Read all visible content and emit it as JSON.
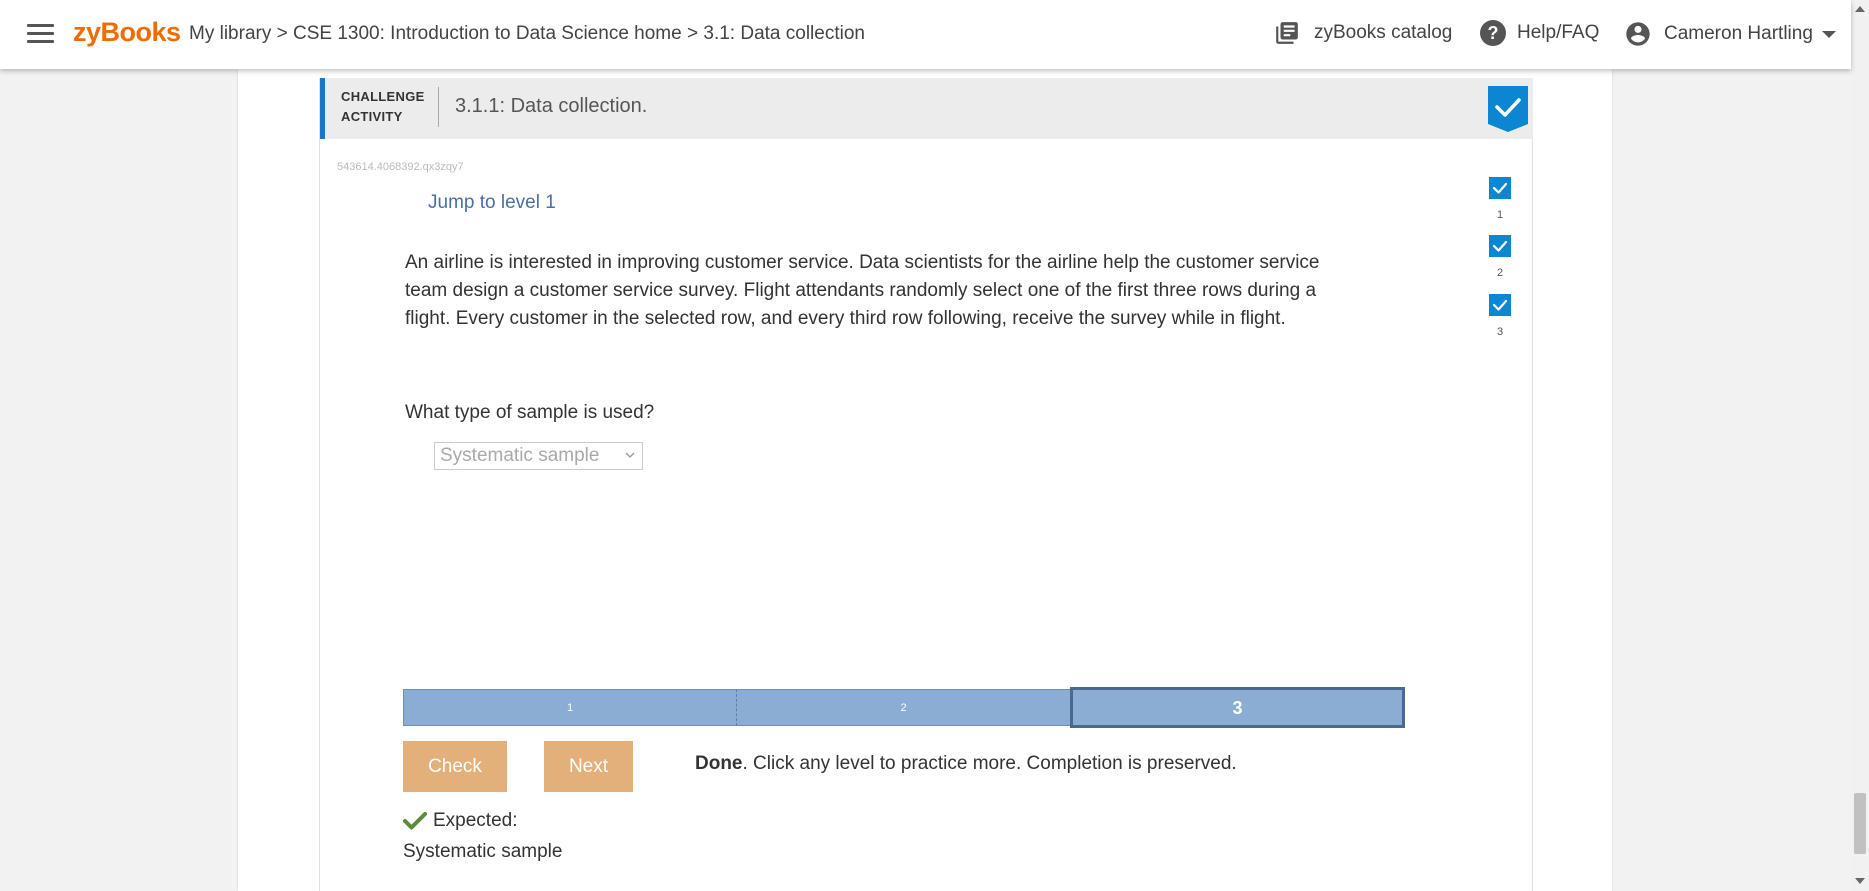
{
  "topbar": {
    "logo": "zyBooks",
    "breadcrumb": {
      "library": "My library",
      "sep1": ">",
      "course": "CSE 1300: Introduction to Data Science home",
      "sep2": ">",
      "section": "3.1: Data collection"
    },
    "catalog_label": "zyBooks catalog",
    "help_label": "Help/FAQ",
    "help_glyph": "?",
    "user_name": "Cameron Hartling"
  },
  "activity": {
    "type_label_line1": "CHALLENGE",
    "type_label_line2": "ACTIVITY",
    "title": "3.1.1: Data collection.",
    "code_id": "543614.4068392.qx3zqy7",
    "jump_label": "Jump to level 1",
    "levels": [
      {
        "num": "1"
      },
      {
        "num": "2"
      },
      {
        "num": "3"
      }
    ],
    "prompt": "An airline is interested in improving customer service. Data scientists for the airline help the customer service team design a customer service survey. Flight attendants randomly select one of the first three rows during a flight. Every customer in the selected row, and every third row following, receive the survey while in flight.",
    "question": "What type of sample is used?",
    "selected_answer": "Systematic sample",
    "progress": [
      "1",
      "2",
      "3"
    ],
    "check_label": "Check",
    "next_label": "Next",
    "done_bold": "Done",
    "done_text": ". Click any level to practice more. Completion is preserved.",
    "expected_label": "Expected:",
    "expected_answer": "Systematic sample"
  },
  "colors": {
    "brand_orange": "#f06c00",
    "accent_blue": "#1a76c6",
    "check_blue": "#0b86d1",
    "progress_blue": "#8badd4",
    "button_tan": "#e3b07b",
    "success_green": "#5a8a3a"
  }
}
